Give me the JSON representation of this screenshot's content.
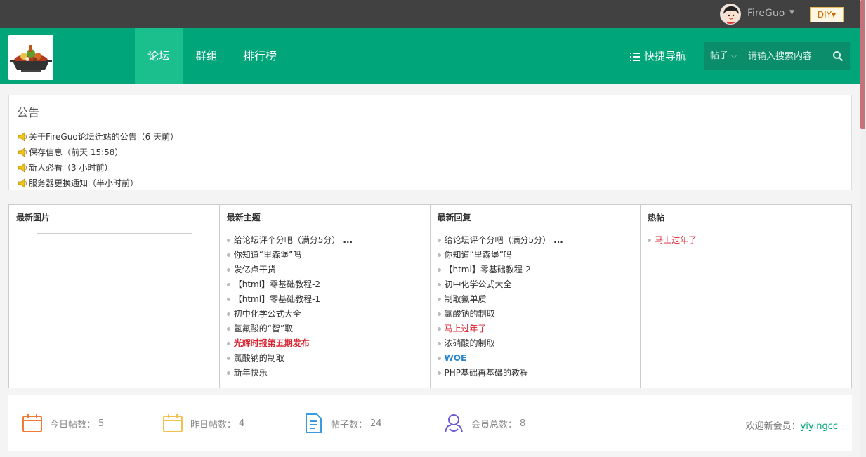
{
  "topbar": {
    "username": "FireGuo",
    "diy_label": "DIY"
  },
  "nav": {
    "items": [
      {
        "label": "论坛",
        "active": true
      },
      {
        "label": "群组",
        "active": false
      },
      {
        "label": "排行榜",
        "active": false
      }
    ],
    "quick_nav_label": "快捷导航",
    "search_type": "帖子",
    "search_placeholder": "请输入搜索内容"
  },
  "notice": {
    "title": "公告",
    "items": [
      "关于FireGuo论坛迁站的公告（6 天前）",
      "保存信息（前天 15:58）",
      "新人必看（3 小时前）",
      "服务器更换通知（半小时前）"
    ]
  },
  "columns": {
    "latest_images": {
      "title": "最新图片"
    },
    "latest_topics": {
      "title": "最新主题",
      "items": [
        {
          "text": "给论坛评个分吧（满分5分）",
          "more": "...",
          "style": ""
        },
        {
          "text": "你知道“里森堡”吗",
          "style": ""
        },
        {
          "text": "发亿点干货",
          "style": ""
        },
        {
          "text": "【html】零基础教程-2",
          "style": ""
        },
        {
          "text": "【html】零基础教程-1",
          "style": ""
        },
        {
          "text": "初中化学公式大全",
          "style": ""
        },
        {
          "text": "氢氟酸的“智”取",
          "style": ""
        },
        {
          "text": "光辉时报第五期发布",
          "style": "bold-red"
        },
        {
          "text": "氯酸钠的制取",
          "style": ""
        },
        {
          "text": "新年快乐",
          "style": ""
        }
      ]
    },
    "latest_replies": {
      "title": "最新回复",
      "items": [
        {
          "text": "给论坛评个分吧（满分5分）",
          "more": "...",
          "style": ""
        },
        {
          "text": "你知道“里森堡”吗",
          "style": ""
        },
        {
          "text": "【html】零基础教程-2",
          "style": ""
        },
        {
          "text": "初中化学公式大全",
          "style": ""
        },
        {
          "text": "制取氟单质",
          "style": ""
        },
        {
          "text": "氯酸钠的制取",
          "style": ""
        },
        {
          "text": "马上过年了",
          "style": "red"
        },
        {
          "text": "浓硝酸的制取",
          "style": ""
        },
        {
          "text": "WOE",
          "style": "blue"
        },
        {
          "text": "PHP基础再基础的教程",
          "style": ""
        }
      ]
    },
    "hot_posts": {
      "title": "热帖",
      "items": [
        {
          "text": "马上过年了",
          "style": "red"
        }
      ]
    }
  },
  "stats": {
    "today_label": "今日帖数：",
    "today_value": "5",
    "yesterday_label": "昨日帖数：",
    "yesterday_value": "4",
    "posts_label": "帖子数：",
    "posts_value": "24",
    "members_label": "会员总数：",
    "members_value": "8",
    "welcome_label": "欢迎新会员：",
    "new_member": "yiyingcc"
  },
  "colors": {
    "brand": "#00a57a",
    "nav_active": "#1bbf8d",
    "topbar": "#414141",
    "highlight_red": "#d9232f",
    "link_blue": "#2a86c9"
  },
  "icons": [
    "user-avatar",
    "logo-hotpot",
    "list-icon",
    "chevron-down-icon",
    "search-icon",
    "horn-icon",
    "calendar-today-icon",
    "calendar-yesterday-icon",
    "document-icon",
    "members-icon"
  ]
}
